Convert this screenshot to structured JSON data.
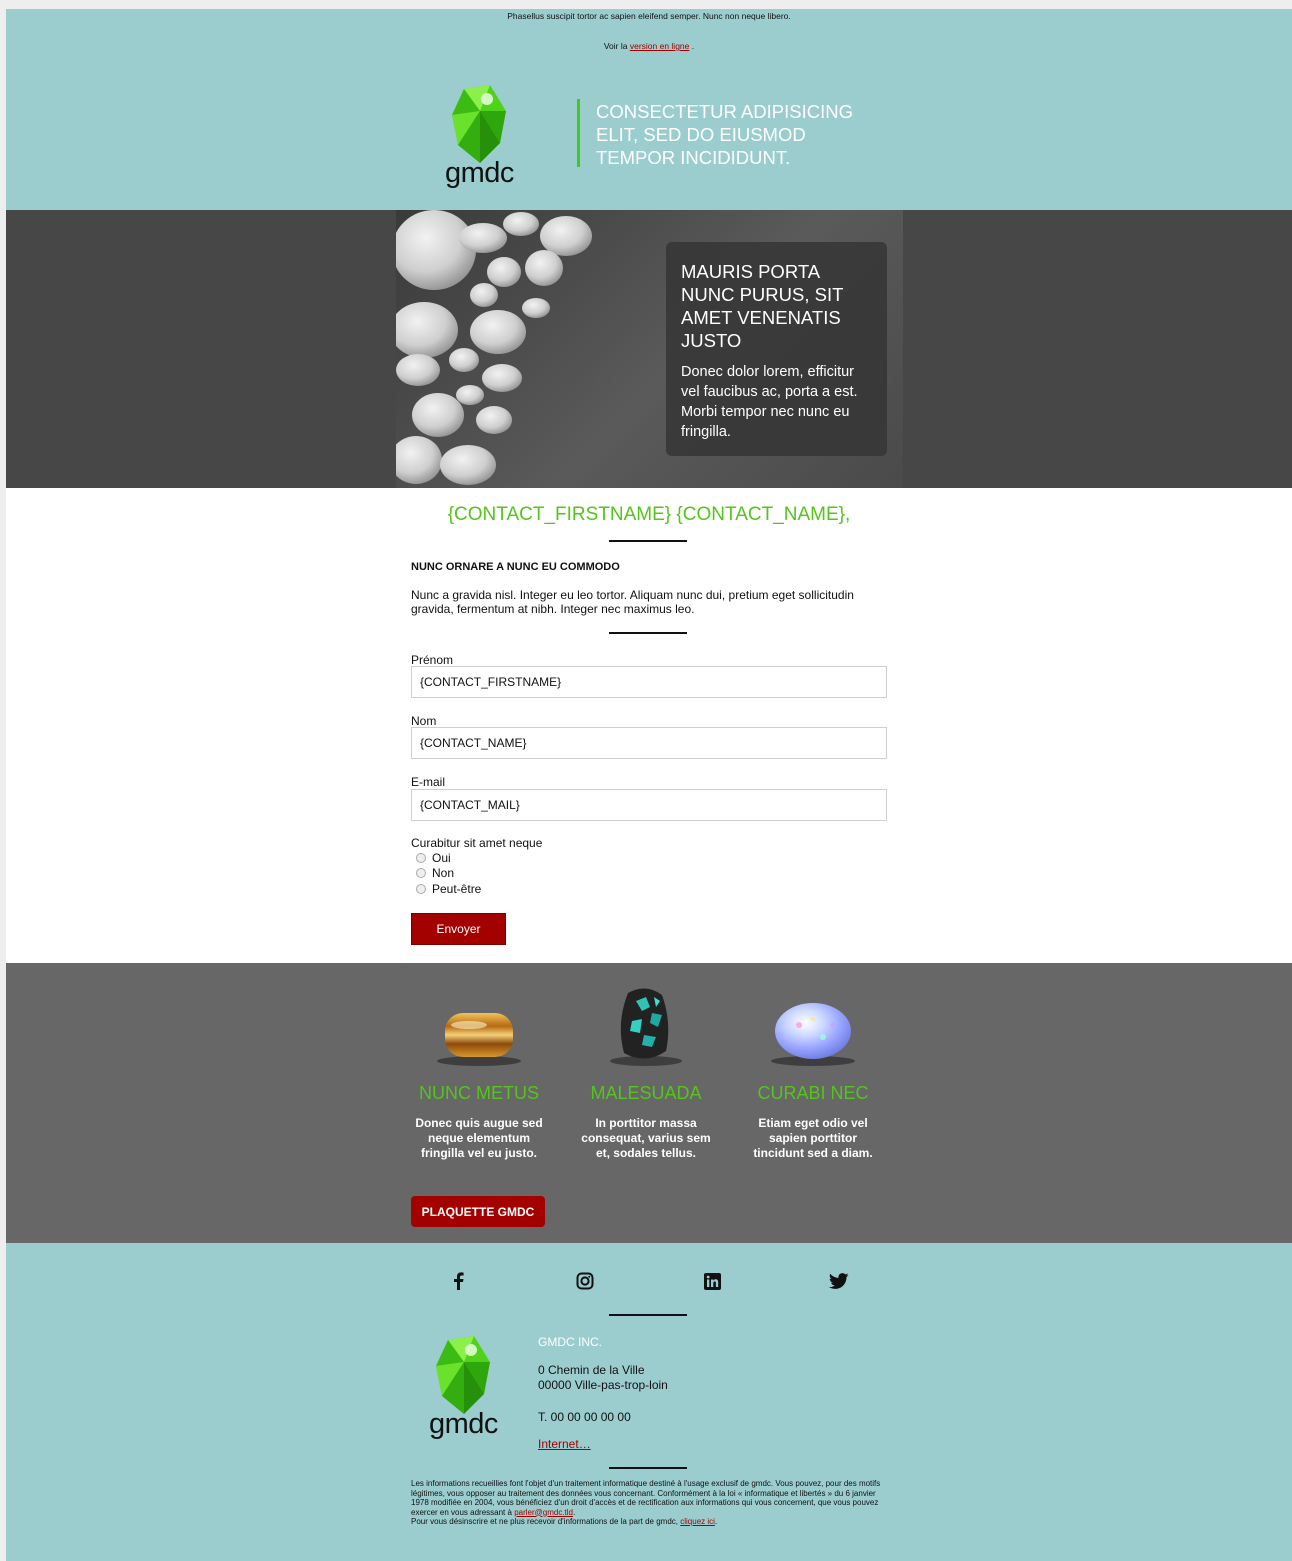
{
  "header": {
    "preheader": "Phasellus suscipit tortor ac sapien eleifend semper. Nunc non neque libero.",
    "view_online_prefix": "Voir la",
    "view_online_link": "version en ligne",
    "view_online_suffix": ".",
    "logo_text": "gmdc",
    "tagline": "CONSECTETUR ADIPISICING ELIT, SED DO EIUSMOD TEMPOR INCIDIDUNT."
  },
  "hero": {
    "title": "MAURIS PORTA NUNC PURUS, SIT AMET VENENATIS JUSTO",
    "text": "Donec dolor lorem, efficitur vel faucibus ac, porta a est. Morbi tempor nec nunc eu fringilla."
  },
  "greeting": "{CONTACT_FIRSTNAME} {CONTACT_NAME},",
  "section": {
    "title": "NUNC ORNARE A NUNC EU COMMODO",
    "intro": "Nunc a gravida nisl. Integer eu leo tortor. Aliquam nunc dui, pretium eget sollicitudin gravida, fermentum at nibh. Integer nec maximus leo."
  },
  "form": {
    "firstname_label": "Prénom",
    "firstname_value": "{CONTACT_FIRSTNAME}",
    "name_label": "Nom",
    "name_value": "{CONTACT_NAME}",
    "email_label": "E-mail",
    "email_value": "{CONTACT_MAIL}",
    "question": "Curabitur sit amet neque",
    "options": [
      "Oui",
      "Non",
      "Peut-être"
    ],
    "submit": "Envoyer"
  },
  "products": [
    {
      "title": "NUNC METUS",
      "text": "Donec quis augue sed neque elementum fringilla vel eu justo.",
      "icon": "tigers-eye-stone-icon"
    },
    {
      "title": "MALESUADA",
      "text": "In porttitor massa consequat, varius sem et, sodales tellus.",
      "icon": "turquoise-stone-icon"
    },
    {
      "title": "CURABI NEC",
      "text": "Etiam eget odio vel sapien porttitor tincidunt sed a diam.",
      "icon": "opal-stone-icon"
    }
  ],
  "brochure_button": "PLAQUETTE GMDC",
  "footer": {
    "social": [
      "facebook-icon",
      "instagram-icon",
      "linkedin-icon",
      "twitter-icon"
    ],
    "logo_text": "gmdc",
    "company": "GMDC INC.",
    "address_line1": "0 Chemin de la Ville",
    "address_line2": "00000 Ville-pas-trop-loin",
    "phone": "T. 00 00 00 00 00",
    "website": "Internet…",
    "legal_text": "Les informations recueillies font l'objet d'un traitement informatique destiné à l'usage exclusif de gmdc. Vous pouvez, pour des motifs légitimes, vous opposer au traitement des données vous concernant. Conformément à la loi « informatique et libertés » du 6 janvier 1978 modifiée en 2004, vous bénéficiez d'un droit d'accès et de rectification aux informations qui vous concernent, que vous pouvez exercer en vous adressant à",
    "legal_email": "parler@gmdc.tld",
    "legal_email_suffix": ".",
    "unsubscribe_text": "Pour vous désinscrire et ne plus recevoir d'informations de la part de gmdc,",
    "unsubscribe_link": "cliquez ici",
    "unsubscribe_suffix": "."
  },
  "colors": {
    "teal": "#9bcdcf",
    "green": "#55c41b",
    "red": "#a30000",
    "dark_gray": "#474747",
    "mid_gray": "#676767"
  }
}
